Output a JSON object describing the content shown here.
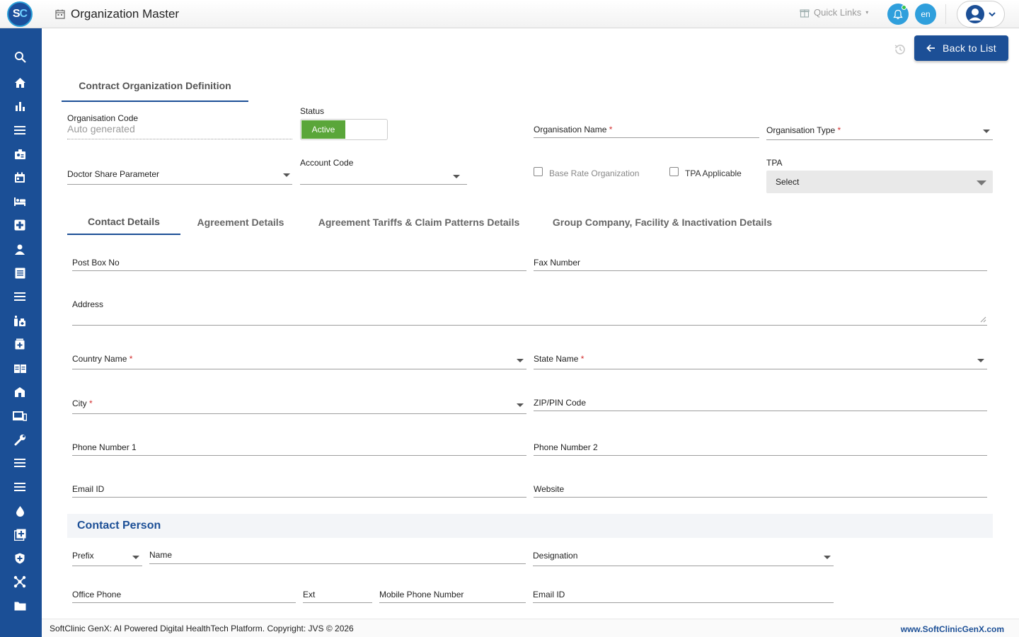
{
  "header": {
    "logo_left": "S",
    "logo_right": "C",
    "title": "Organization Master",
    "quick_links": "Quick Links",
    "language": "en"
  },
  "sidebar": {
    "items": [
      "search-icon",
      "home-icon",
      "bar-chart-icon",
      "menu-icon",
      "id-badge-icon",
      "calendar-icon",
      "bed-icon",
      "medical-plus-icon",
      "user-icon",
      "document-icon",
      "menu-icon",
      "pharmacy-icon",
      "medicine-box-icon",
      "book-icon",
      "building-icon",
      "devices-icon",
      "wrench-icon",
      "menu-icon",
      "menu-icon",
      "drop-icon",
      "add-box-icon",
      "shield-icon",
      "network-icon",
      "folder-icon"
    ]
  },
  "actions": {
    "back_label": "Back to List"
  },
  "main_tab": "Contract Organization Definition",
  "form": {
    "org_code_label": "Organisation Code",
    "org_code_value": "Auto generated",
    "status_label": "Status",
    "status_value": "Active",
    "org_name_label": "Organisation Name",
    "org_type_label": "Organisation Type",
    "doctor_share_label": "Doctor Share Parameter",
    "account_code_label": "Account Code",
    "base_rate_label": "Base Rate Organization",
    "tpa_applicable_label": "TPA Applicable",
    "tpa_label": "TPA",
    "tpa_value": "Select",
    "required_mark": "*"
  },
  "subtabs": [
    "Contact Details",
    "Agreement Details",
    "Agreement Tariffs & Claim Patterns Details",
    "Group Company, Facility & Inactivation Details"
  ],
  "contact": {
    "post_box": "Post Box No",
    "fax": "Fax Number",
    "address": "Address",
    "country": "Country Name",
    "state": "State Name",
    "city": "City",
    "zip": "ZIP/PIN Code",
    "phone1": "Phone Number 1",
    "phone2": "Phone Number 2",
    "email": "Email ID",
    "website": "Website"
  },
  "contact_person": {
    "title": "Contact Person",
    "prefix": "Prefix",
    "name": "Name",
    "designation": "Designation",
    "office_phone": "Office Phone",
    "ext": "Ext",
    "mobile": "Mobile Phone Number",
    "email": "Email ID"
  },
  "footer": {
    "copyright": "SoftClinic GenX: AI Powered Digital HealthTech Platform. Copyright: JVS © 2026",
    "website": "www.SoftClinicGenX.com"
  },
  "colors": {
    "brand": "#1c4f96",
    "active_green": "#5aa63a",
    "accent": "#2f9fdc",
    "required": "#d32f2f"
  }
}
